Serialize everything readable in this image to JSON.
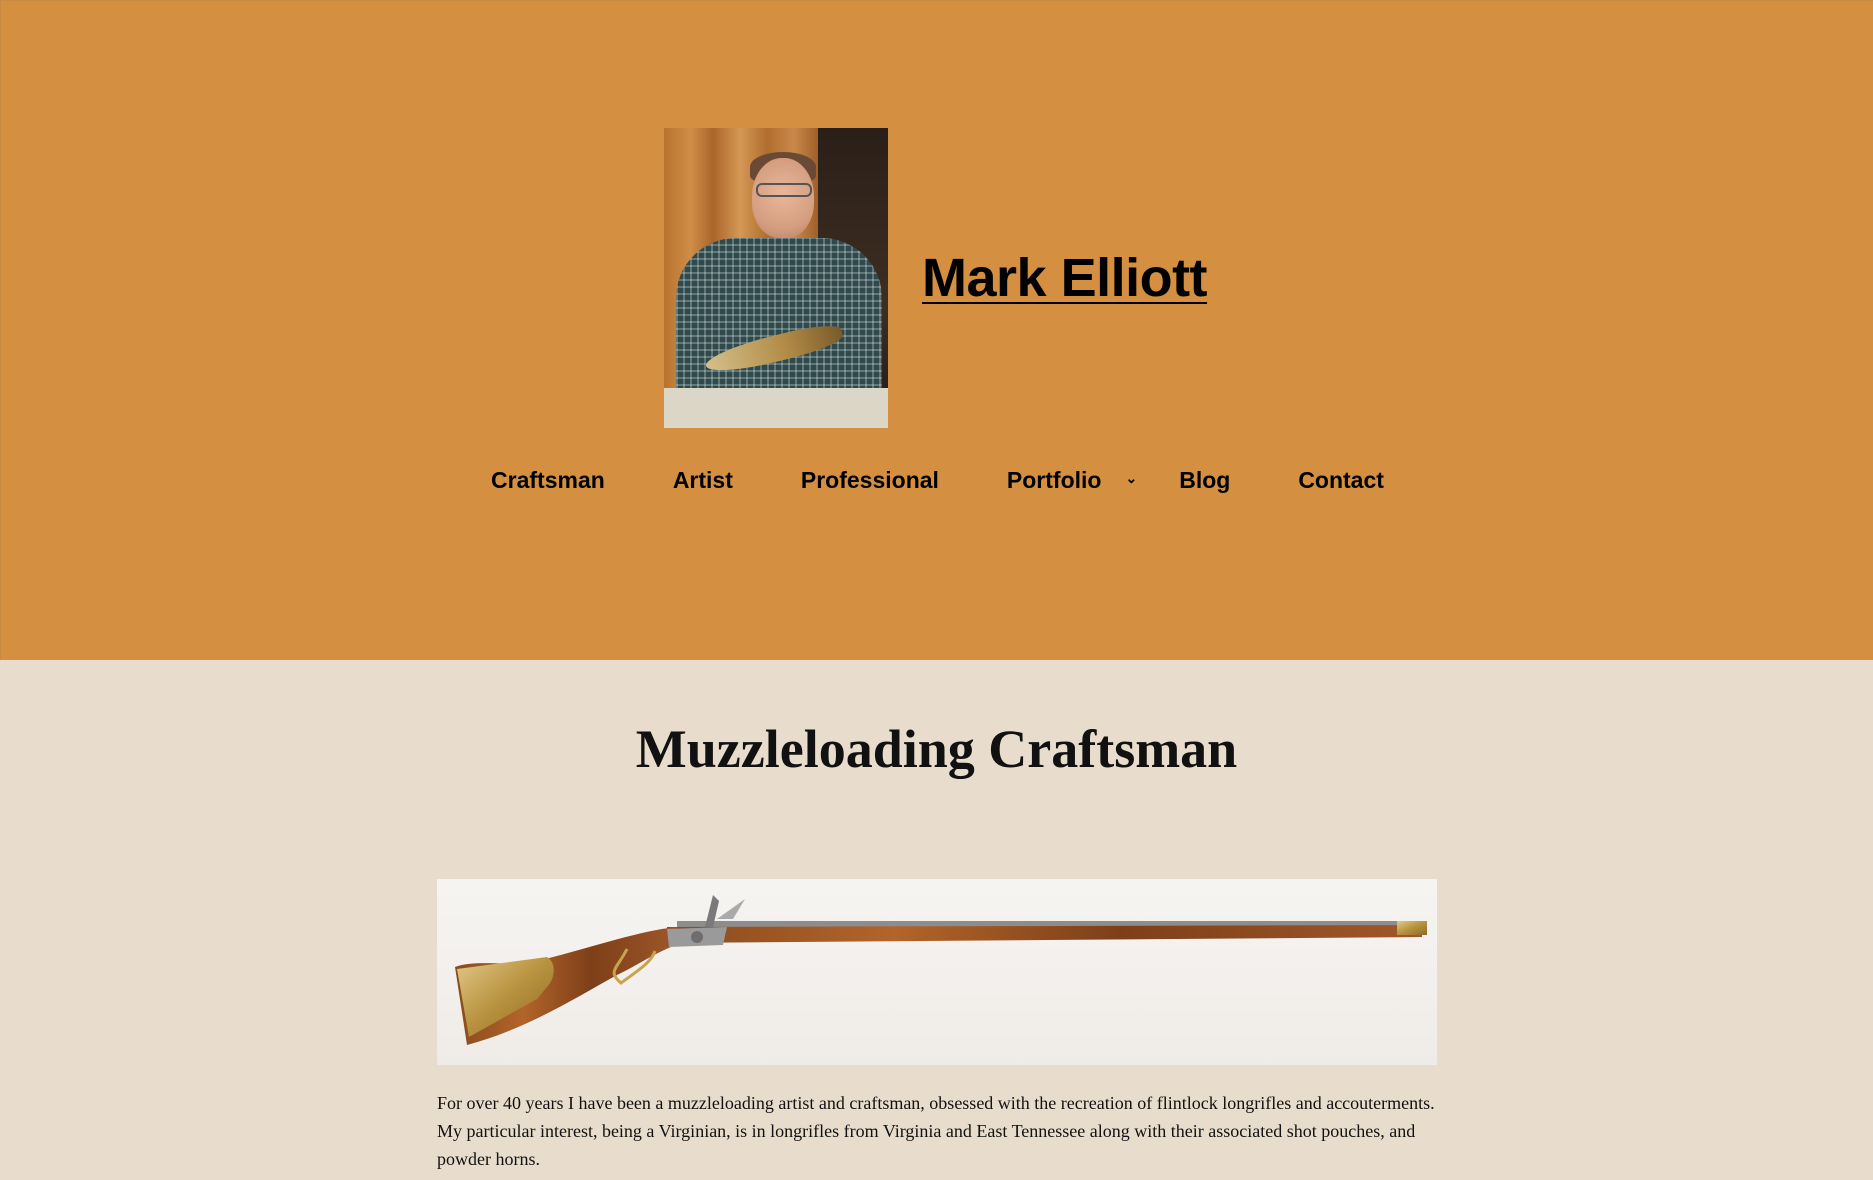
{
  "header": {
    "site_title": "Mark Elliott",
    "background_color": "#d48f41"
  },
  "nav": {
    "items": [
      {
        "label": "Craftsman",
        "has_submenu": false
      },
      {
        "label": "Artist",
        "has_submenu": false
      },
      {
        "label": "Professional",
        "has_submenu": false
      },
      {
        "label": "Portfolio",
        "has_submenu": true
      },
      {
        "label": "Blog",
        "has_submenu": false
      },
      {
        "label": "Contact",
        "has_submenu": false
      }
    ],
    "submenu_icon": "chevron-down-icon"
  },
  "main": {
    "page_title": "Muzzleloading Craftsman",
    "intro": "For over 40 years I have been a muzzleloading artist and craftsman, obsessed with the recreation of flintlock longrifles and accouterments. My particular interest, being a Virginian, is in longrifles from Virginia and East Tennessee along with their associated shot pouches, and powder horns.",
    "background_color": "#e8ddcc"
  }
}
